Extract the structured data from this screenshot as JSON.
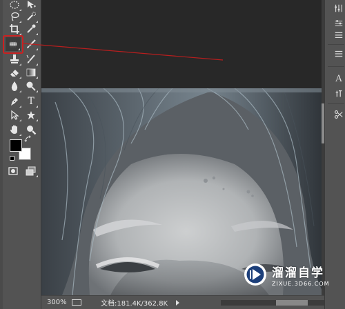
{
  "status": {
    "zoom": "300%",
    "doc_info": "文档:181.4K/362.8K"
  },
  "watermark": {
    "title": "溜溜自学",
    "subtitle": "ZIXUE.3D66.COM"
  },
  "toolbar": {
    "tools": [
      {
        "name": "elliptical-marquee-tool",
        "icon": "ellipse-icon"
      },
      {
        "name": "move-tool",
        "icon": "move-icon"
      },
      {
        "name": "lasso-tool",
        "icon": "lasso-icon"
      },
      {
        "name": "quick-selection-tool",
        "icon": "magic-wand-icon"
      },
      {
        "name": "crop-tool",
        "icon": "crop-icon"
      },
      {
        "name": "eyedropper-tool",
        "icon": "eyedropper-icon"
      },
      {
        "name": "spot-healing-brush-tool",
        "icon": "healing-brush-icon"
      },
      {
        "name": "brush-tool",
        "icon": "brush-icon"
      },
      {
        "name": "clone-stamp-tool",
        "icon": "stamp-icon"
      },
      {
        "name": "history-brush-tool",
        "icon": "history-brush-icon"
      },
      {
        "name": "eraser-tool",
        "icon": "eraser-icon"
      },
      {
        "name": "gradient-tool",
        "icon": "gradient-icon"
      },
      {
        "name": "blur-tool",
        "icon": "blur-icon"
      },
      {
        "name": "dodge-tool",
        "icon": "dodge-icon"
      },
      {
        "name": "pen-tool",
        "icon": "pen-icon"
      },
      {
        "name": "type-tool",
        "label": "T",
        "icon": "type-icon"
      },
      {
        "name": "path-selection-tool",
        "icon": "arrow-icon"
      },
      {
        "name": "custom-shape-tool",
        "icon": "shape-icon"
      },
      {
        "name": "hand-tool",
        "icon": "hand-icon"
      },
      {
        "name": "zoom-tool",
        "icon": "zoom-icon"
      }
    ],
    "selected_tool": "spot-healing-brush-tool",
    "foreground_color": "#000000",
    "background_color": "#ffffff"
  },
  "right_panel": {
    "icons": [
      "adjust-icon",
      "sliders-icon",
      "layers-icon",
      "type-panel-icon",
      "paragraph-icon",
      "scissors-icon"
    ],
    "type_label": "A"
  },
  "colors": {
    "annotation": "#cc2020",
    "ui_dark": "#535353",
    "canvas_bg": "#282828"
  }
}
